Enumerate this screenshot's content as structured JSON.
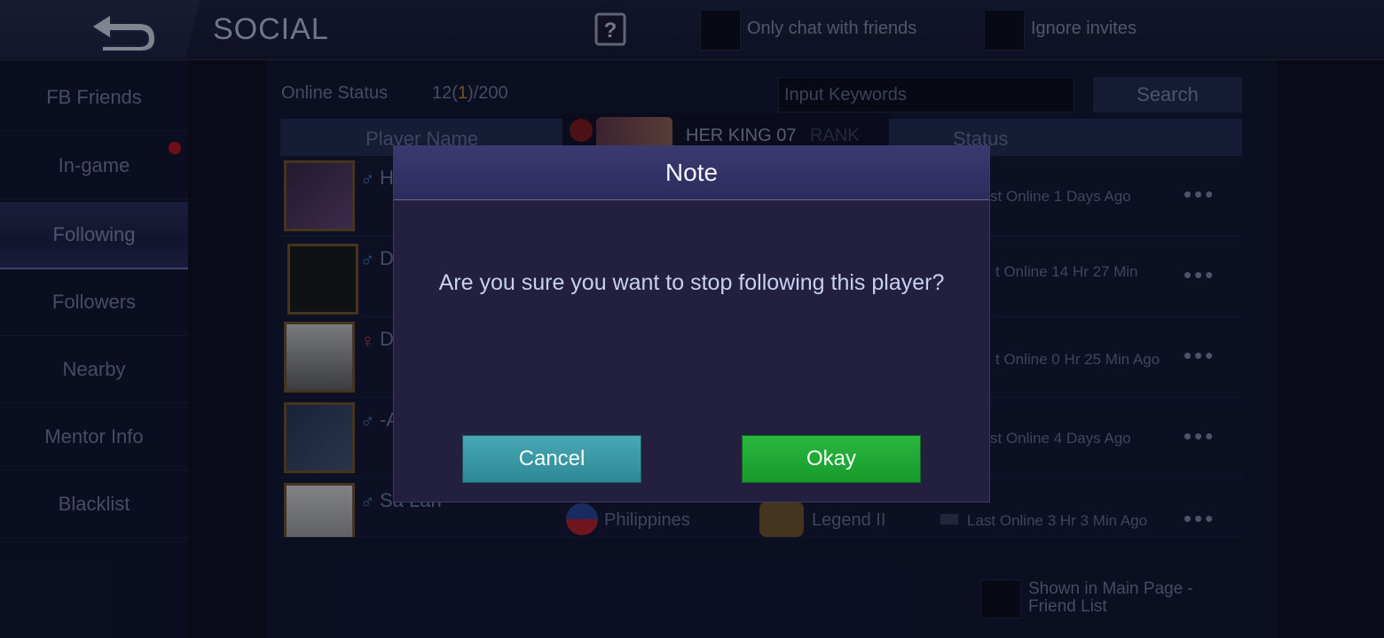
{
  "header": {
    "title": "SOCIAL",
    "only_chat_friends_label": "Only chat with friends",
    "ignore_invites_label": "Ignore invites"
  },
  "sidebar": {
    "items": [
      {
        "label": "FB Friends"
      },
      {
        "label": "In-game"
      },
      {
        "label": "Following"
      },
      {
        "label": "Followers"
      },
      {
        "label": "Nearby"
      },
      {
        "label": "Mentor Info"
      },
      {
        "label": "Blacklist"
      }
    ],
    "active": "Following"
  },
  "main": {
    "online_status_label": "Online Status",
    "online_count_prefix": "12(",
    "online_count_highlight": "1",
    "online_count_suffix": ")/200",
    "search_placeholder": "Input Keywords",
    "search_button": "Search",
    "columns": {
      "player_name": "Player Name",
      "status": "Status"
    },
    "rank_chip": {
      "name": "HER KING 07",
      "suffix": "RANK"
    },
    "rows": [
      {
        "gender": "♂",
        "name_frag": "H",
        "status": "st Online 1 Days Ago"
      },
      {
        "gender": "♂",
        "name_frag": "D",
        "status": "t Online 14 Hr 27 Min"
      },
      {
        "gender": "♀",
        "name_frag": "D",
        "status": "t Online 0 Hr 25 Min Ago"
      },
      {
        "gender": "♂",
        "name_frag": "-A",
        "status": "st Online 4 Days Ago"
      },
      {
        "gender": "♂",
        "name_frag": "Sa Lan",
        "country": "Philippines",
        "rank": "Legend II",
        "status": "Last Online 3 Hr 3 Min Ago"
      }
    ],
    "footer_label": "Shown in Main Page - Friend List"
  },
  "modal": {
    "title": "Note",
    "message": "Are you sure you want to stop following this player?",
    "cancel_label": "Cancel",
    "okay_label": "Okay"
  },
  "colors": {
    "accent_teal": "#2c8894",
    "accent_green": "#17992c",
    "notification_red": "#c8151f"
  },
  "icons": [
    "back-arrow-icon",
    "help-book-icon",
    "more-dots-icon",
    "gender-male-icon",
    "gender-female-icon",
    "friend-icon"
  ]
}
